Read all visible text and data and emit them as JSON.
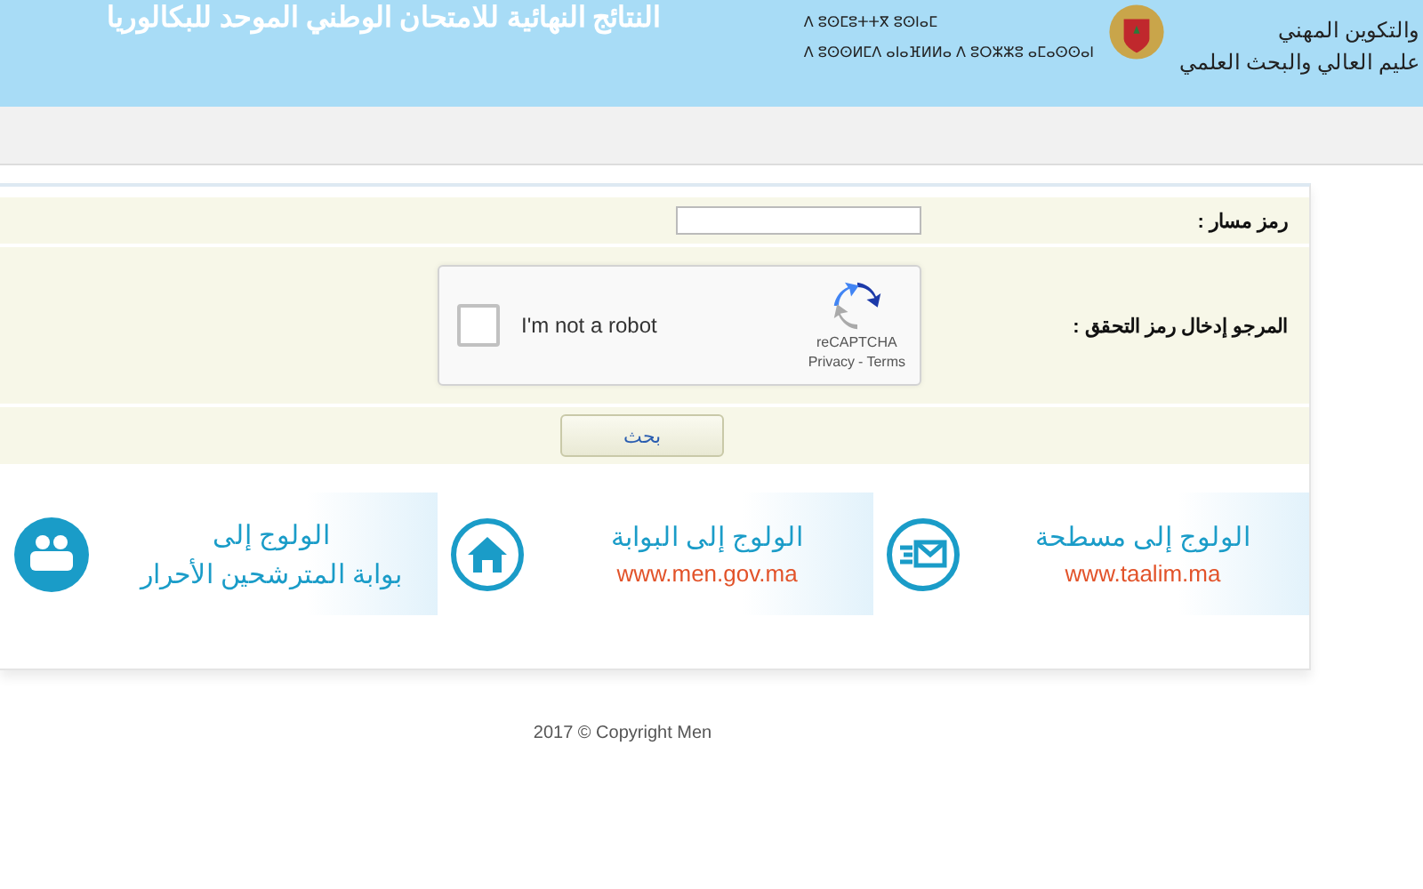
{
  "header": {
    "title": "النتائج النهائية للامتحان الوطني الموحد للبكالوريا",
    "ministry_tifinagh": [
      "ⴷ ⵓⵙⵎⵓⵜⵜⴳ ⵓⵙⵏⴰⵎ",
      "ⴷ ⵓⵙⵙⵍⵎⴷ ⴰⵏⴰⴼⵍⵍⴰ ⴷ ⵓⵔⵣⵣⵓ ⴰⵎⴰⵙⵙⴰⵏ"
    ],
    "ministry_arabic": [
      "والتكوين المهني",
      "عليم العالي والبحث العلمي"
    ]
  },
  "form": {
    "code_label": "رمز مسار :",
    "captcha_label": "المرجو إدخال رمز التحقق :",
    "captcha": {
      "checked": false,
      "text": "I'm not a robot",
      "brand": "reCAPTCHA",
      "privacy": "Privacy",
      "separator": "-",
      "terms": "Terms"
    },
    "submit": "بحث"
  },
  "banners": [
    {
      "kind": "mail",
      "lines": [
        "الولوج إلى مسطحة",
        "www.taalim.ma"
      ]
    },
    {
      "kind": "home",
      "lines": [
        "الولوج إلى البوابة",
        "www.men.gov.ma"
      ]
    },
    {
      "kind": "candidates",
      "lines": [
        "الولوج إلى",
        "بوابة المترشحين الأحرار"
      ]
    }
  ],
  "footer": "2017 © Copyright Men"
}
